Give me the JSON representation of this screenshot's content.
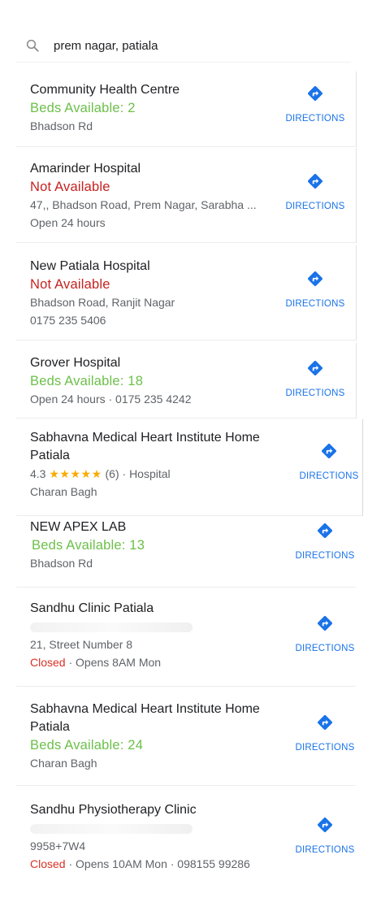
{
  "search": {
    "icon": "search-icon",
    "query": "prem nagar, patiala"
  },
  "colors": {
    "available": "#6cc04a",
    "not_available": "#c5221f",
    "link": "#1a73e8",
    "star": "#f9ab00",
    "closed": "#d93025"
  },
  "results": [
    {
      "name": "Community Health Centre",
      "status": "Beds Available: 2",
      "address": "Bhadson Rd",
      "direction_label": "DIRECTIONS"
    },
    {
      "name": "Amarinder Hospital",
      "status": "Not Available",
      "address": "47,, Bhadson Road, Prem Nagar, Sarabha ...",
      "hours": "Open 24 hours",
      "direction_label": "DIRECTIONS"
    },
    {
      "name": "New Patiala Hospital",
      "status": "Not Available",
      "address": "Bhadson Road, Ranjit Nagar",
      "phone": "0175 235 5406",
      "direction_label": "DIRECTIONS"
    },
    {
      "name": "Grover Hospital",
      "status": "Beds Available: 18",
      "hours_phone": "Open 24 hours · 0175 235 4242",
      "direction_label": "DIRECTIONS"
    },
    {
      "name": "Sabhavna Medical Heart Institute Home Patiala",
      "rating": "4.3",
      "stars": "★★★★★",
      "rating_meta": "(6) · Hospital",
      "address": "Charan Bagh",
      "direction_label": "DIRECTIONS"
    },
    {
      "name": "NEW APEX LAB",
      "status": "Beds Available: 13",
      "address": "Bhadson Rd",
      "direction_label": "DIRECTIONS"
    },
    {
      "name": "Sandhu Clinic Patiala",
      "address": "21, Street Number 8",
      "closed": "Closed",
      "opens": " · Opens 8AM Mon",
      "direction_label": "DIRECTIONS"
    },
    {
      "name": "Sabhavna Medical Heart Institute Home Patiala",
      "status": "Beds Available: 24",
      "address": "Charan Bagh",
      "direction_label": "DIRECTIONS"
    },
    {
      "name": "Sandhu Physiotherapy Clinic",
      "plus_code": "9958+7W4",
      "closed": "Closed",
      "opens": " · Opens 10AM Mon · 098155 99286",
      "direction_label": "DIRECTIONS"
    }
  ]
}
